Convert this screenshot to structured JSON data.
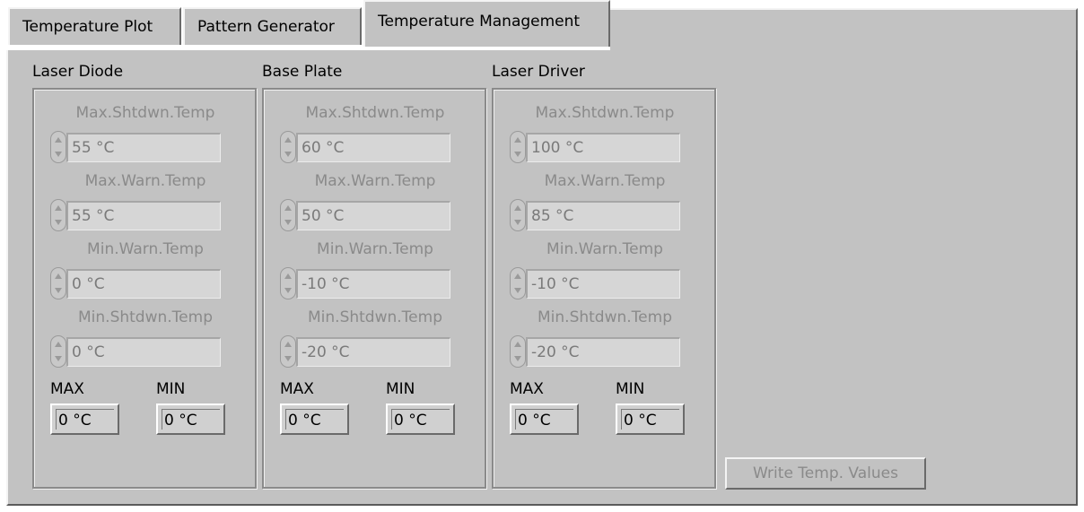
{
  "tabs": [
    {
      "label": "Temperature Plot",
      "active": false
    },
    {
      "label": "Pattern Generator",
      "active": false
    },
    {
      "label": "Temperature Management",
      "active": true
    }
  ],
  "groups": [
    {
      "title": "Laser Diode",
      "max_shtdwn": {
        "label": "Max.Shtdwn.Temp",
        "value": "55 °C"
      },
      "max_warn": {
        "label": "Max.Warn.Temp",
        "value": "55 °C"
      },
      "min_warn": {
        "label": "Min.Warn.Temp",
        "value": "0 °C"
      },
      "min_shtdwn": {
        "label": "Min.Shtdwn.Temp",
        "value": "0 °C"
      },
      "max_label": "MAX",
      "min_label": "MIN",
      "max_value": "0 °C",
      "min_value": "0 °C"
    },
    {
      "title": "Base Plate",
      "max_shtdwn": {
        "label": "Max.Shtdwn.Temp",
        "value": "60 °C"
      },
      "max_warn": {
        "label": "Max.Warn.Temp",
        "value": "50 °C"
      },
      "min_warn": {
        "label": "Min.Warn.Temp",
        "value": "-10 °C"
      },
      "min_shtdwn": {
        "label": "Min.Shtdwn.Temp",
        "value": "-20 °C"
      },
      "max_label": "MAX",
      "min_label": "MIN",
      "max_value": "0 °C",
      "min_value": "0 °C"
    },
    {
      "title": "Laser Driver",
      "max_shtdwn": {
        "label": "Max.Shtdwn.Temp",
        "value": "100 °C"
      },
      "max_warn": {
        "label": "Max.Warn.Temp",
        "value": "85 °C"
      },
      "min_warn": {
        "label": "Min.Warn.Temp",
        "value": "-10 °C"
      },
      "min_shtdwn": {
        "label": "Min.Shtdwn.Temp",
        "value": "-20 °C"
      },
      "max_label": "MAX",
      "min_label": "MIN",
      "max_value": "0 °C",
      "min_value": "0 °C"
    }
  ],
  "write_button": {
    "label": "Write Temp. Values",
    "enabled": false
  },
  "colors": {
    "panel": "#c2c2c2",
    "disabled_text": "#8a8a8a"
  }
}
